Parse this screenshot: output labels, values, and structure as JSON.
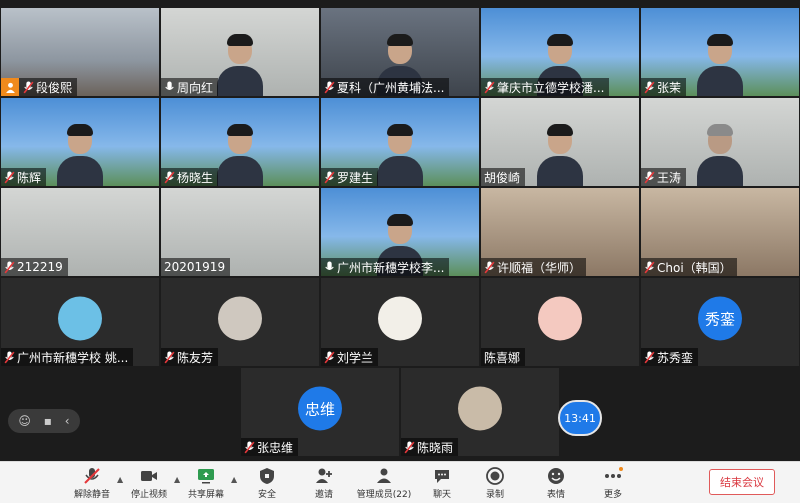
{
  "participants": [
    {
      "name": "段俊熙",
      "host": true
    },
    {
      "name": "周向红"
    },
    {
      "name": "夏科（广州黄埔法..."
    },
    {
      "name": "肇庆市立德学校潘..."
    },
    {
      "name": "张茉"
    },
    {
      "name": "陈辉"
    },
    {
      "name": "杨晓生"
    },
    {
      "name": "罗建生"
    },
    {
      "name": "胡俊崎"
    },
    {
      "name": "王涛"
    },
    {
      "name": "212219"
    },
    {
      "name": "20201919"
    },
    {
      "name": "广州市新穗学校李..."
    },
    {
      "name": "许顺福（华师）"
    },
    {
      "name": "Choi（韩国）"
    },
    {
      "name": "广州市新穗学校 姚..."
    },
    {
      "name": "陈友芳"
    },
    {
      "name": "刘学兰"
    },
    {
      "name": "陈喜娜"
    },
    {
      "name": "苏秀銮",
      "avatar_text": "秀銮"
    },
    {
      "name": "张忠维",
      "avatar_text": "忠维"
    },
    {
      "name": "陈晓雨"
    }
  ],
  "clock": "13:41",
  "toolbar": {
    "unmute": "解除静音",
    "stop_video": "停止视频",
    "share_screen": "共享屏幕",
    "security": "安全",
    "invite": "邀请",
    "members": "管理成员(22)",
    "chat": "聊天",
    "record": "录制",
    "reactions": "表情",
    "more": "更多",
    "end": "结束会议"
  },
  "colors": {
    "accent": "#1f7ae8",
    "end": "#d9363e",
    "host_badge": "#f08a1c"
  }
}
